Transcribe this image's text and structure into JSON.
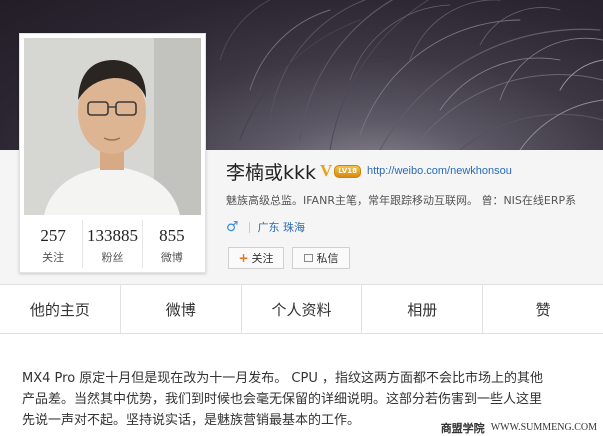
{
  "profile": {
    "screen_name": "李楠或kkk",
    "verified_mark": "V",
    "level_badge": "LV18",
    "url": "http://weibo.com/newkhonsou",
    "bio": "魅族高级总监。IFANR主笔，常年跟踪移动互联网。 曾：NIS在线ERP系",
    "gender_icon": "male-icon",
    "gender_symbol": "♂",
    "location": "广东 珠海"
  },
  "stats": [
    {
      "value": "257",
      "label": "关注"
    },
    {
      "value": "133885",
      "label": "粉丝"
    },
    {
      "value": "855",
      "label": "微博"
    }
  ],
  "actions": {
    "follow_label": "关注",
    "message_label": "私信"
  },
  "tabs": [
    {
      "label": "他的主页"
    },
    {
      "label": "微博"
    },
    {
      "label": "个人资料"
    },
    {
      "label": "相册"
    },
    {
      "label": "赞"
    }
  ],
  "post": {
    "lines": [
      "MX4 Pro 原定十月但是现在改为十一月发布。 CPU ，指纹这两方面都不会比市场上的其他",
      "产品差。当然其中优势，我们到时候也会毫无保留的详细说明。这部分若伤害到一些人这里",
      "先说一声对不起。坚持说实话，是魅族营销最基本的工作。"
    ]
  },
  "watermark": {
    "text": "商盟学院",
    "url": "WWW.SUMMENG.COM"
  },
  "colors": {
    "link": "#2b6bb5",
    "verified": "#e8a317",
    "male": "#3b8fe0"
  }
}
